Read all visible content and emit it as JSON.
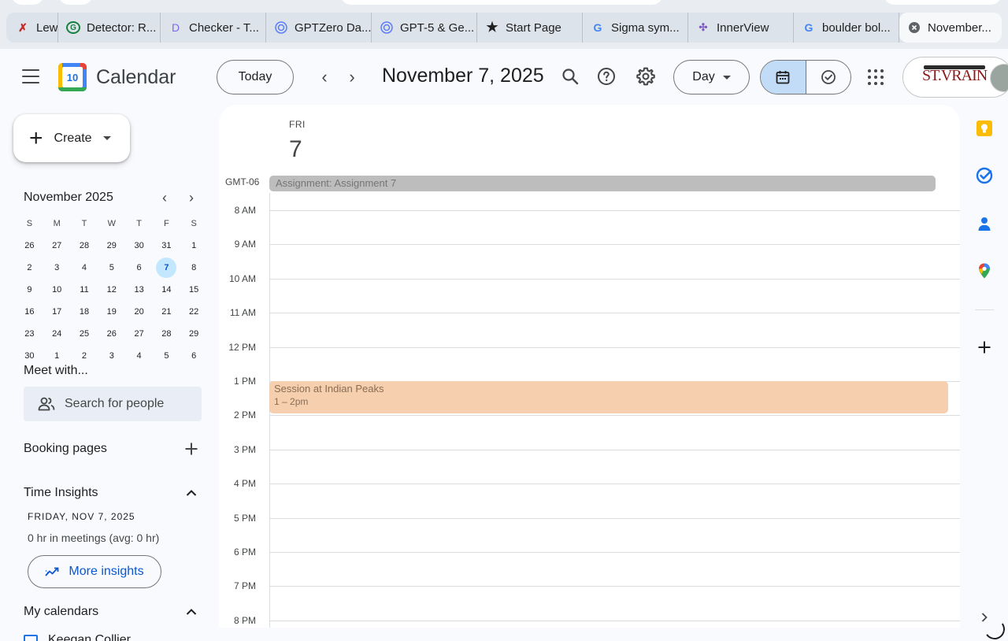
{
  "browser_tabs": [
    {
      "label": "Lewi",
      "icon": "x-red-icon",
      "active": false
    },
    {
      "label": "Detector: R...",
      "icon": "grammarly-g-icon",
      "active": false
    },
    {
      "label": "Checker - T...",
      "icon": "doc-d-icon",
      "active": false
    },
    {
      "label": "GPTZero Da...",
      "icon": "spiral-icon",
      "active": false
    },
    {
      "label": "GPT-5 & Ge...",
      "icon": "spiral-icon",
      "active": false
    },
    {
      "label": "Start Page",
      "icon": "star-icon",
      "active": false
    },
    {
      "label": "Sigma sym...",
      "icon": "google-g-icon",
      "active": false
    },
    {
      "label": "InnerView",
      "icon": "innerview-icon",
      "active": false
    },
    {
      "label": "boulder bol...",
      "icon": "google-g-icon",
      "active": false
    },
    {
      "label": "November...",
      "icon": "close-circle-icon",
      "active": true
    }
  ],
  "header": {
    "app_title": "Calendar",
    "logo_day": "10",
    "today_label": "Today",
    "date_title": "November 7, 2025",
    "view_label": "Day",
    "org_logo_text": "ST.VRAIN"
  },
  "sidebar": {
    "create_label": "Create",
    "mini_calendar": {
      "title": "November 2025",
      "weekday_headers": [
        "S",
        "M",
        "T",
        "W",
        "T",
        "F",
        "S"
      ],
      "weeks": [
        [
          "26",
          "27",
          "28",
          "29",
          "30",
          "31",
          "1"
        ],
        [
          "2",
          "3",
          "4",
          "5",
          "6",
          "7",
          "8"
        ],
        [
          "9",
          "10",
          "11",
          "12",
          "13",
          "14",
          "15"
        ],
        [
          "16",
          "17",
          "18",
          "19",
          "20",
          "21",
          "22"
        ],
        [
          "23",
          "24",
          "25",
          "26",
          "27",
          "28",
          "29"
        ],
        [
          "30",
          "1",
          "2",
          "3",
          "4",
          "5",
          "6"
        ]
      ],
      "selected": "7"
    },
    "meet_with": "Meet with...",
    "search_people_placeholder": "Search for people",
    "booking_pages": "Booking pages",
    "time_insights": "Time Insights",
    "insights_date": "FRIDAY, NOV 7, 2025",
    "insights_meetings": "0 hr in meetings (avg: 0 hr)",
    "more_insights": "More insights",
    "my_calendars": "My calendars",
    "calendar_owner": "Keegan Collier"
  },
  "day_view": {
    "day_name": "FRI",
    "day_number": "7",
    "timezone": "GMT-06",
    "all_day_event": "Assignment: Assignment 7",
    "hours": [
      "8 AM",
      "9 AM",
      "10 AM",
      "11 AM",
      "12 PM",
      "1 PM",
      "2 PM",
      "3 PM",
      "4 PM",
      "5 PM",
      "6 PM",
      "7 PM",
      "8 PM"
    ],
    "event": {
      "title": "Session at Indian Peaks",
      "time": "1 – 2pm"
    }
  },
  "colors": {
    "accent": "#0b57d0",
    "selected_day_bg": "#c2e7ff",
    "event_bg": "#f6cfae",
    "allday_event_bg": "#bdbdbd"
  }
}
